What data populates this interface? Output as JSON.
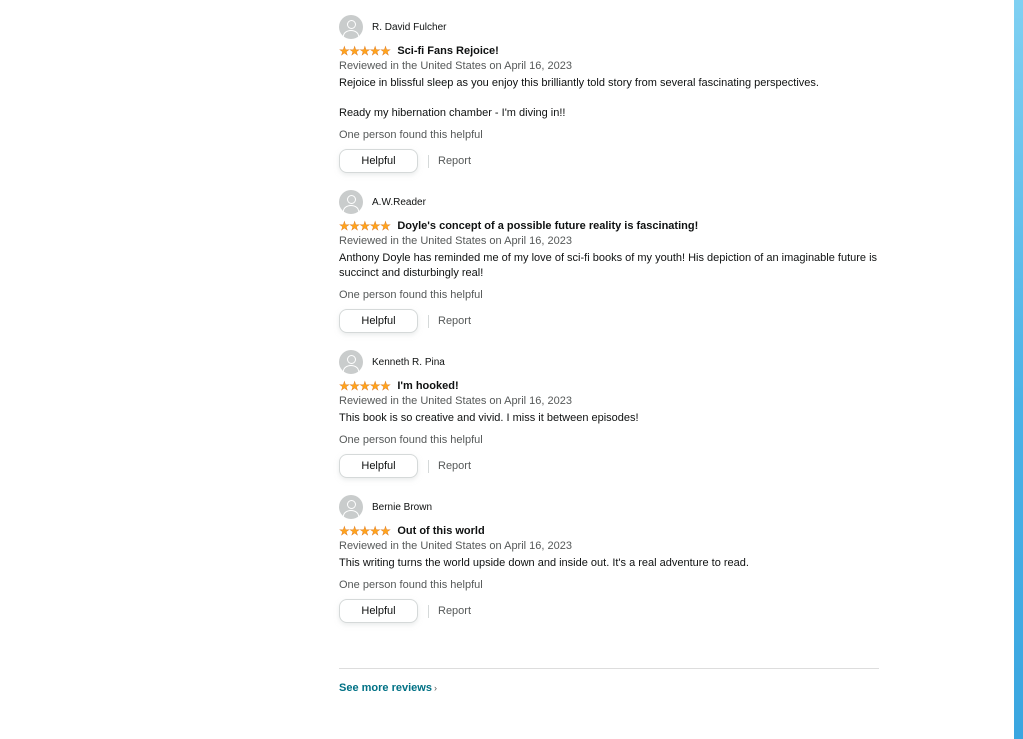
{
  "reviews": [
    {
      "profile_name": "R. David Fulcher",
      "title": "Sci-fi Fans Rejoice!",
      "date": "Reviewed in the United States on April 16, 2023",
      "body": [
        "Rejoice in blissful sleep as you enjoy this brilliantly told story from several fascinating perspectives.",
        "Ready my hibernation chamber - I'm diving in!!"
      ],
      "helpful_count": "One person found this helpful",
      "helpful_label": "Helpful",
      "report_label": "Report"
    },
    {
      "profile_name": "A.W.Reader",
      "title": "Doyle's concept of a possible future reality is fascinating!",
      "date": "Reviewed in the United States on April 16, 2023",
      "body": [
        "Anthony Doyle has reminded me of my love of sci-fi books of my youth! His depiction of an imaginable future is succinct and disturbingly real!"
      ],
      "helpful_count": "One person found this helpful",
      "helpful_label": "Helpful",
      "report_label": "Report"
    },
    {
      "profile_name": "Kenneth R. Pina",
      "title": "I'm hooked!",
      "date": "Reviewed in the United States on April 16, 2023",
      "body": [
        "This book is so creative and vivid. I miss it between episodes!"
      ],
      "helpful_count": "One person found this helpful",
      "helpful_label": "Helpful",
      "report_label": "Report"
    },
    {
      "profile_name": "Bernie Brown",
      "title": "Out of this world",
      "date": "Reviewed in the United States on April 16, 2023",
      "body": [
        "This writing turns the world upside down and inside out. It's a real adventure to read."
      ],
      "helpful_count": "One person found this helpful",
      "helpful_label": "Helpful",
      "report_label": "Report"
    }
  ],
  "rating": {
    "stars": 5,
    "max": 5,
    "star_glyph": "★",
    "star_color": "#ffa41c",
    "icon": "star-icon"
  },
  "see_more": {
    "label": "See more reviews",
    "chevron": "›",
    "link_color": "#007185"
  },
  "avatar_icon": "default-user-avatar-icon"
}
